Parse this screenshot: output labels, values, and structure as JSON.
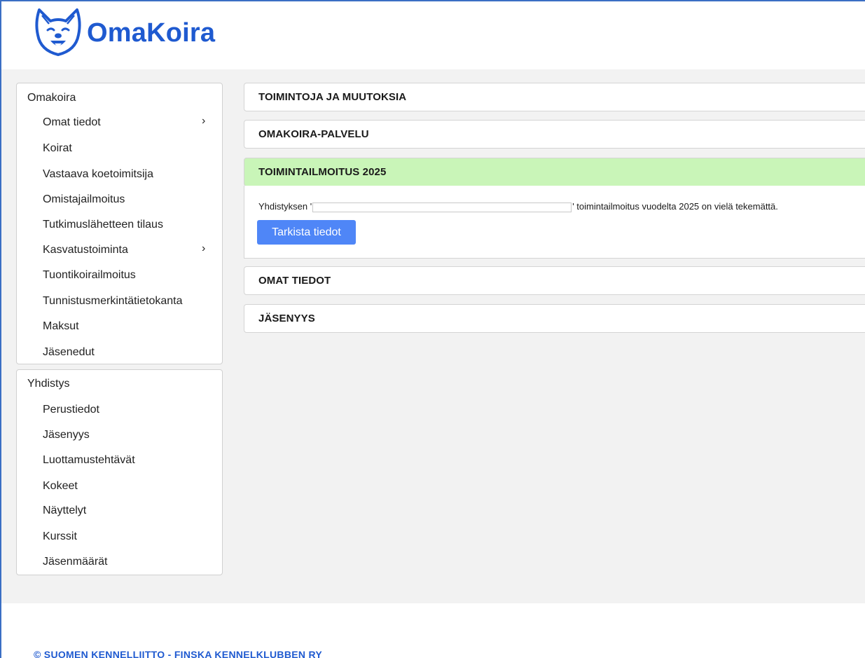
{
  "brand": {
    "name": "OmaKoira",
    "logo_icon": "dog-face-icon",
    "accent": "#1f5ad0"
  },
  "sidebar": {
    "omakoira": {
      "heading": "Omakoira",
      "items": [
        {
          "label": "Omat tiedot",
          "has_submenu": true
        },
        {
          "label": "Koirat",
          "has_submenu": false
        },
        {
          "label": "Vastaava koetoimitsija",
          "has_submenu": false
        },
        {
          "label": "Omistajailmoitus",
          "has_submenu": false
        },
        {
          "label": "Tutkimuslähetteen tilaus",
          "has_submenu": false
        },
        {
          "label": "Kasvatustoiminta",
          "has_submenu": true
        },
        {
          "label": "Tuontikoirailmoitus",
          "has_submenu": false
        },
        {
          "label": "Tunnistusmerkintätietokanta",
          "has_submenu": false
        },
        {
          "label": "Maksut",
          "has_submenu": false
        },
        {
          "label": "Jäsenedut",
          "has_submenu": false
        }
      ]
    },
    "yhdistys": {
      "heading": "Yhdistys",
      "items": [
        {
          "label": "Perustiedot"
        },
        {
          "label": "Jäsenyys"
        },
        {
          "label": "Luottamustehtävät"
        },
        {
          "label": "Kokeet"
        },
        {
          "label": "Näyttelyt"
        },
        {
          "label": "Kurssit"
        },
        {
          "label": "Jäsenmäärät"
        }
      ]
    },
    "chevron_glyph": "›"
  },
  "panels": [
    {
      "title": "TOIMINTOJA JA MUUTOKSIA"
    },
    {
      "title": "OMAKOIRA-PALVELU"
    },
    {
      "title": "TOIMINTAILMOITUS 2025",
      "highlight_color": "#c9f5b8"
    },
    {
      "title": "OMAT TIEDOT"
    },
    {
      "title": "JÄSENYYS"
    }
  ],
  "notice": {
    "text_before": "Yhdistyksen '",
    "text_after": "' toimintailmoitus vuodelta 2025 on vielä tekemättä.",
    "button_label": "Tarkista tiedot",
    "button_color": "#4f86f7"
  },
  "footer": {
    "text": "© SUOMEN KENNELLIITTO - FINSKA KENNELKLUBBEN RY"
  }
}
